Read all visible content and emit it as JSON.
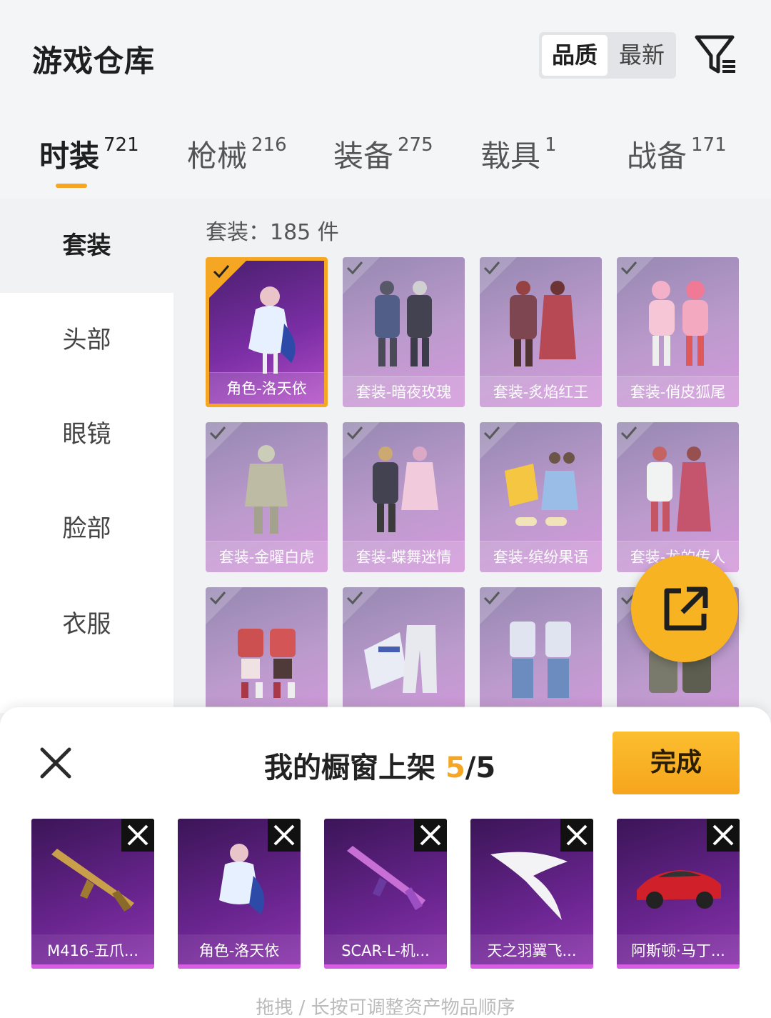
{
  "header": {
    "title": "游戏仓库",
    "sort_options": [
      "品质",
      "最新"
    ],
    "active_sort": "品质",
    "filter_icon": "filter-icon"
  },
  "tabs": [
    {
      "label": "时装",
      "count": "721",
      "active": true
    },
    {
      "label": "枪械",
      "count": "216",
      "active": false
    },
    {
      "label": "装备",
      "count": "275",
      "active": false
    },
    {
      "label": "载具",
      "count": "1",
      "active": false
    },
    {
      "label": "战备",
      "count": "171",
      "active": false
    }
  ],
  "sidebar": {
    "items": [
      {
        "label": "套装",
        "active": true
      },
      {
        "label": "头部",
        "active": false
      },
      {
        "label": "眼镜",
        "active": false
      },
      {
        "label": "脸部",
        "active": false
      },
      {
        "label": "衣服",
        "active": false
      }
    ]
  },
  "main": {
    "section_count": "套装：185 件",
    "items": [
      {
        "label": "角色-洛天依",
        "selected": true
      },
      {
        "label": "套装-暗夜玫瑰",
        "selected": false
      },
      {
        "label": "套装-炙焰红王",
        "selected": false
      },
      {
        "label": "套装-俏皮狐尾",
        "selected": false
      },
      {
        "label": "套装-金曜白虎",
        "selected": false
      },
      {
        "label": "套装-蝶舞迷情",
        "selected": false
      },
      {
        "label": "套装-缤纷果语",
        "selected": false
      },
      {
        "label": "套装-龙的传人",
        "selected": false
      },
      {
        "label": "",
        "selected": false
      },
      {
        "label": "",
        "selected": false
      },
      {
        "label": "",
        "selected": false
      },
      {
        "label": "",
        "selected": false
      }
    ],
    "share_icon": "share-external-icon"
  },
  "panel": {
    "title_prefix": "我的橱窗上架 ",
    "count_current": "5",
    "count_total": "/5",
    "done_label": "完成",
    "slots": [
      {
        "label": "M416-五爪...",
        "icon": "rifle-icon"
      },
      {
        "label": "角色-洛天依",
        "icon": "character-icon"
      },
      {
        "label": "SCAR-L-机...",
        "icon": "rifle-icon"
      },
      {
        "label": "天之羽翼飞...",
        "icon": "wings-icon"
      },
      {
        "label": "阿斯顿·马丁...",
        "icon": "car-icon"
      }
    ],
    "hint": "拖拽 / 长按可调整资产物品顺序"
  },
  "colors": {
    "accent": "#f5a623",
    "card_purple": "#b68fc9",
    "slot_purple": "#6a2590"
  }
}
